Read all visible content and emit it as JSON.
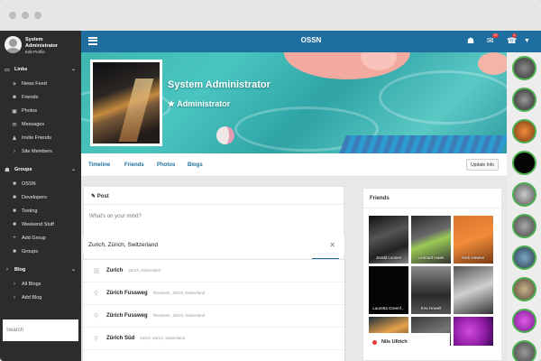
{
  "app": {
    "title": "OSSN"
  },
  "user": {
    "name": "System Administrator",
    "edit_label": "Edit Profile",
    "role": "Administrator"
  },
  "sidebar": {
    "links_heading": "Links",
    "links": [
      "News Feed",
      "Friends",
      "Photos",
      "Messages",
      "Invite Friends",
      "Site Members"
    ],
    "groups_heading": "Groups",
    "groups": [
      "OSSN",
      "Developers",
      "Testing",
      "Weekend Stuff",
      "Add Group",
      "Groups"
    ],
    "blog_heading": "Blog",
    "blog": [
      "All Blogs",
      "Add Blog"
    ],
    "search_placeholder": "Search"
  },
  "topbar": {
    "messages_badge": "22",
    "notifications_badge": "1"
  },
  "profile_tabs": [
    "Timeline",
    "Friends",
    "Photos",
    "Blogs"
  ],
  "update_button": "Update Info",
  "post": {
    "heading": "Post",
    "placeholder": "What's on your mind?",
    "location_value": "Zurich, Zürich, Switzerland"
  },
  "location_suggestions": [
    {
      "name": "Zurich",
      "detail": "Zürich, Switzerland"
    },
    {
      "name": "Zürich Fussweg",
      "detail": "Flüelenstr., Zürich, Switzerland"
    },
    {
      "name": "Zürich Fussweg",
      "detail": "Flüelenstr., Zürich, Switzerland"
    },
    {
      "name": "Zürich Süd",
      "detail": "Zürich, Zürich, Switzerland"
    }
  ],
  "friends": {
    "heading": "Friends",
    "tiles": [
      "Jerald Loosen",
      "Leonard Hawk",
      "Nick Hawker",
      "Lauretta Greenf...",
      "Kira Howell",
      "",
      "",
      "",
      ""
    ],
    "next_name": "Nils Ullrich"
  },
  "colors": {
    "accent": "#1e6f9f",
    "sidebar": "#2c2c2c",
    "online": "#4caf50",
    "badge": "#e53935"
  }
}
